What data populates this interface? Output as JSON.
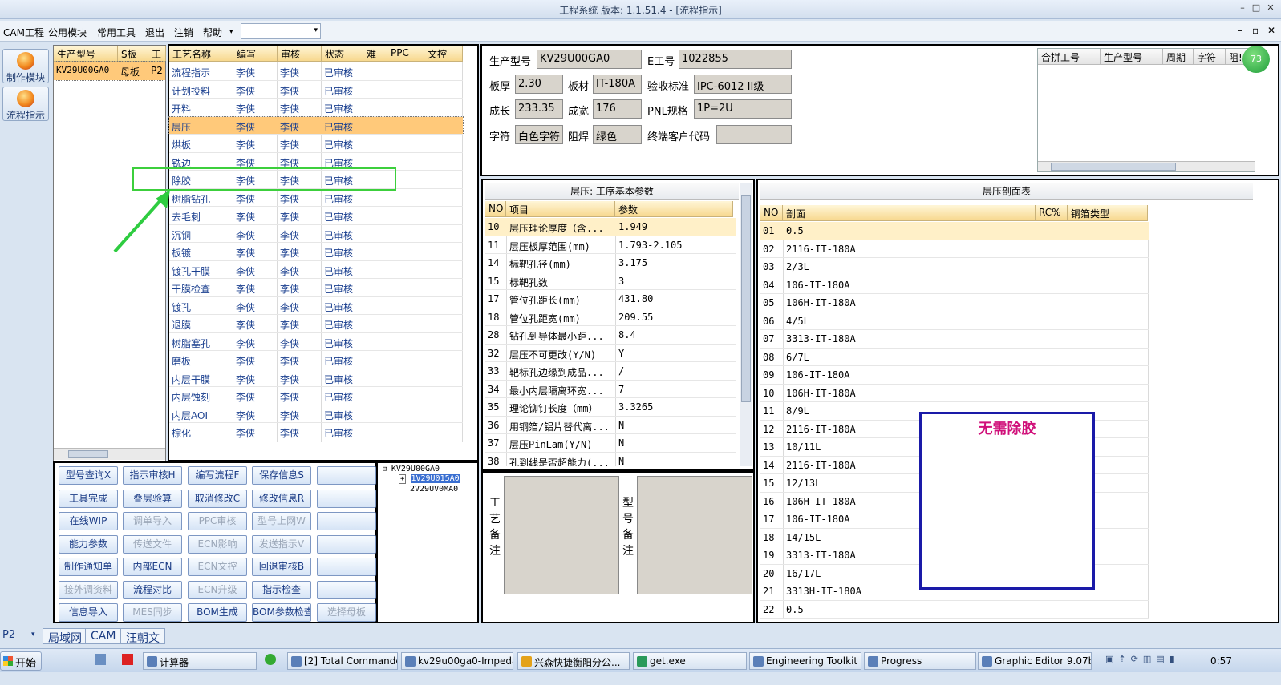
{
  "window": {
    "title": "工程系统  版本: 1.1.51.4 - [流程指示]"
  },
  "menu": [
    "CAM工程",
    "公用模块",
    "常用工具",
    "退出",
    "注销",
    "帮助"
  ],
  "menu_arrow": "▾",
  "left_tools": [
    "制作模块",
    "流程指示"
  ],
  "lot_table": {
    "headers": [
      "生产型号",
      "S板",
      "工"
    ],
    "rows": [
      [
        "KV29U00GA0",
        "母板",
        "P2"
      ]
    ]
  },
  "process_table": {
    "headers": [
      "工艺名称",
      "编写",
      "审核",
      "状态",
      "难",
      "PPC",
      "文控"
    ],
    "rows": [
      [
        "流程指示",
        "李侠",
        "李侠",
        "已审核"
      ],
      [
        "计划投料",
        "李侠",
        "李侠",
        "已审核"
      ],
      [
        "开料",
        "李侠",
        "李侠",
        "已审核"
      ],
      [
        "层压",
        "李侠",
        "李侠",
        "已审核"
      ],
      [
        "烘板",
        "李侠",
        "李侠",
        "已审核"
      ],
      [
        "铣边",
        "李侠",
        "李侠",
        "已审核"
      ],
      [
        "除胶",
        "李侠",
        "李侠",
        "已审核"
      ],
      [
        "树脂钻孔",
        "李侠",
        "李侠",
        "已审核"
      ],
      [
        "去毛刺",
        "李侠",
        "李侠",
        "已审核"
      ],
      [
        "沉铜",
        "李侠",
        "李侠",
        "已审核"
      ],
      [
        "板镀",
        "李侠",
        "李侠",
        "已审核"
      ],
      [
        "镀孔干膜",
        "李侠",
        "李侠",
        "已审核"
      ],
      [
        "干膜检查",
        "李侠",
        "李侠",
        "已审核"
      ],
      [
        "镀孔",
        "李侠",
        "李侠",
        "已审核"
      ],
      [
        "退膜",
        "李侠",
        "李侠",
        "已审核"
      ],
      [
        "树脂塞孔",
        "李侠",
        "李侠",
        "已审核"
      ],
      [
        "磨板",
        "李侠",
        "李侠",
        "已审核"
      ],
      [
        "内层干膜",
        "李侠",
        "李侠",
        "已审核"
      ],
      [
        "内层蚀刻",
        "李侠",
        "李侠",
        "已审核"
      ],
      [
        "内层AOI",
        "李侠",
        "李侠",
        "已审核"
      ],
      [
        "棕化",
        "李侠",
        "李侠",
        "已审核"
      ]
    ],
    "selected_index": 3,
    "highlighted_index": 6
  },
  "buttons": [
    [
      "型号查询X",
      "指示审核H",
      "编写流程F",
      "保存信息S",
      ""
    ],
    [
      "工具完成",
      "叠层验算",
      "取消修改C",
      "修改信息R",
      ""
    ],
    [
      "在线WIP",
      "调单导入",
      "PPC审核",
      "型号上网W",
      ""
    ],
    [
      "能力参数",
      "传送文件",
      "ECN影响",
      "发送指示V",
      ""
    ],
    [
      "制作通知单",
      "内部ECN",
      "ECN文控",
      "回退审核B",
      ""
    ],
    [
      "接外调资料",
      "流程对比",
      "ECN升级",
      "指示检查",
      ""
    ],
    [
      "信息导入",
      "MES同步",
      "BOM生成",
      "BOM参数检查",
      "选择母板"
    ]
  ],
  "buttons_disabled": [
    [
      false,
      false,
      false,
      false,
      false
    ],
    [
      false,
      false,
      false,
      false,
      false
    ],
    [
      false,
      true,
      true,
      true,
      false
    ],
    [
      false,
      true,
      true,
      true,
      false
    ],
    [
      false,
      false,
      true,
      false,
      false
    ],
    [
      true,
      false,
      true,
      false,
      false
    ],
    [
      false,
      true,
      false,
      false,
      true
    ]
  ],
  "tree": {
    "root": "KV29U00GA0",
    "children": [
      "1V29U015A0",
      "2V29UV0MA0"
    ],
    "expander": "+"
  },
  "info": {
    "fields": [
      [
        "生产型号",
        "KV29U00GA0"
      ],
      [
        "E工号",
        "1022855"
      ],
      [
        "板厚",
        "2.30"
      ],
      [
        "板材",
        "IT-180A"
      ],
      [
        "验收标准",
        "IPC-6012 II级"
      ],
      [
        "成长",
        "233.35"
      ],
      [
        "成宽",
        "176"
      ],
      [
        "PNL规格",
        "1P=2U"
      ],
      [
        "字符",
        "白色字符"
      ],
      [
        "阻焊",
        "绿色"
      ],
      [
        "终端客户代码",
        ""
      ]
    ]
  },
  "merge_table": {
    "headers": [
      "合拼工号",
      "生产型号",
      "周期",
      "字符",
      "阻!"
    ]
  },
  "params": {
    "title": "层压: 工序基本参数",
    "headers": [
      "NO",
      "项目",
      "参数"
    ],
    "rows": [
      [
        "10",
        "层压理论厚度（含...",
        "1.949"
      ],
      [
        "11",
        "层压板厚范围(mm)",
        "1.793-2.105"
      ],
      [
        "14",
        "标靶孔径(mm)",
        "3.175"
      ],
      [
        "15",
        "标靶孔数",
        "3"
      ],
      [
        "17",
        "管位孔距长(mm)",
        "431.80"
      ],
      [
        "18",
        "管位孔距宽(mm)",
        "209.55"
      ],
      [
        "28",
        "钻孔到导体最小距...",
        "8.4"
      ],
      [
        "32",
        "层压不可更改(Y/N)",
        "Y"
      ],
      [
        "33",
        "靶标孔边缘到成品...",
        "/"
      ],
      [
        "34",
        "最小内层隔离环宽...",
        "7"
      ],
      [
        "35",
        "理论铆钉长度（mm）",
        "3.3265"
      ],
      [
        "36",
        "用铜箔/铝片替代离...",
        "N"
      ],
      [
        "37",
        "层压PinLam(Y/N)",
        "N"
      ],
      [
        "38",
        "孔到线是否超能力(...",
        "N"
      ]
    ]
  },
  "notes": {
    "process_label": "工艺备注",
    "model_label": "型号备注"
  },
  "stack": {
    "title": "层压剖面表",
    "headers": [
      "NO",
      "剖面",
      "RC%",
      "铜箔类型"
    ],
    "rows": [
      [
        "01",
        "0.5"
      ],
      [
        "02",
        "2116-IT-180A"
      ],
      [
        "03",
        "2/3L"
      ],
      [
        "04",
        "106-IT-180A"
      ],
      [
        "05",
        "106H-IT-180A"
      ],
      [
        "06",
        "4/5L"
      ],
      [
        "07",
        "3313-IT-180A"
      ],
      [
        "08",
        "6/7L"
      ],
      [
        "09",
        "106-IT-180A"
      ],
      [
        "10",
        "106H-IT-180A"
      ],
      [
        "11",
        "8/9L"
      ],
      [
        "12",
        "2116-IT-180A"
      ],
      [
        "13",
        "10/11L"
      ],
      [
        "14",
        "2116-IT-180A"
      ],
      [
        "15",
        "12/13L"
      ],
      [
        "16",
        "106H-IT-180A"
      ],
      [
        "17",
        "106-IT-180A"
      ],
      [
        "18",
        "14/15L"
      ],
      [
        "19",
        "3313-IT-180A"
      ],
      [
        "20",
        "16/17L"
      ],
      [
        "21",
        "3313H-IT-180A"
      ],
      [
        "22",
        "0.5"
      ]
    ],
    "annotation": "无需除胶"
  },
  "status_tabs": {
    "combo": "P2",
    "tabs": [
      "局域网",
      "CAM",
      "汪朝文"
    ]
  },
  "badge": "73",
  "taskbar": {
    "start": "开始",
    "items": [
      "计算器",
      "[2] Total Commander ...",
      "kv29u00ga0-Impedan...",
      "兴森快捷衡阳分公...",
      "get.exe",
      "Engineering Toolkit 9....",
      "Progress",
      "Graphic Editor 9.07b2..."
    ],
    "time": "0:57"
  },
  "colors": {
    "annotation_box": "#1a1aa8",
    "annotation_text": "#d0107a",
    "arrow": "#2ecc40",
    "highlight": "#3ccf3c"
  }
}
